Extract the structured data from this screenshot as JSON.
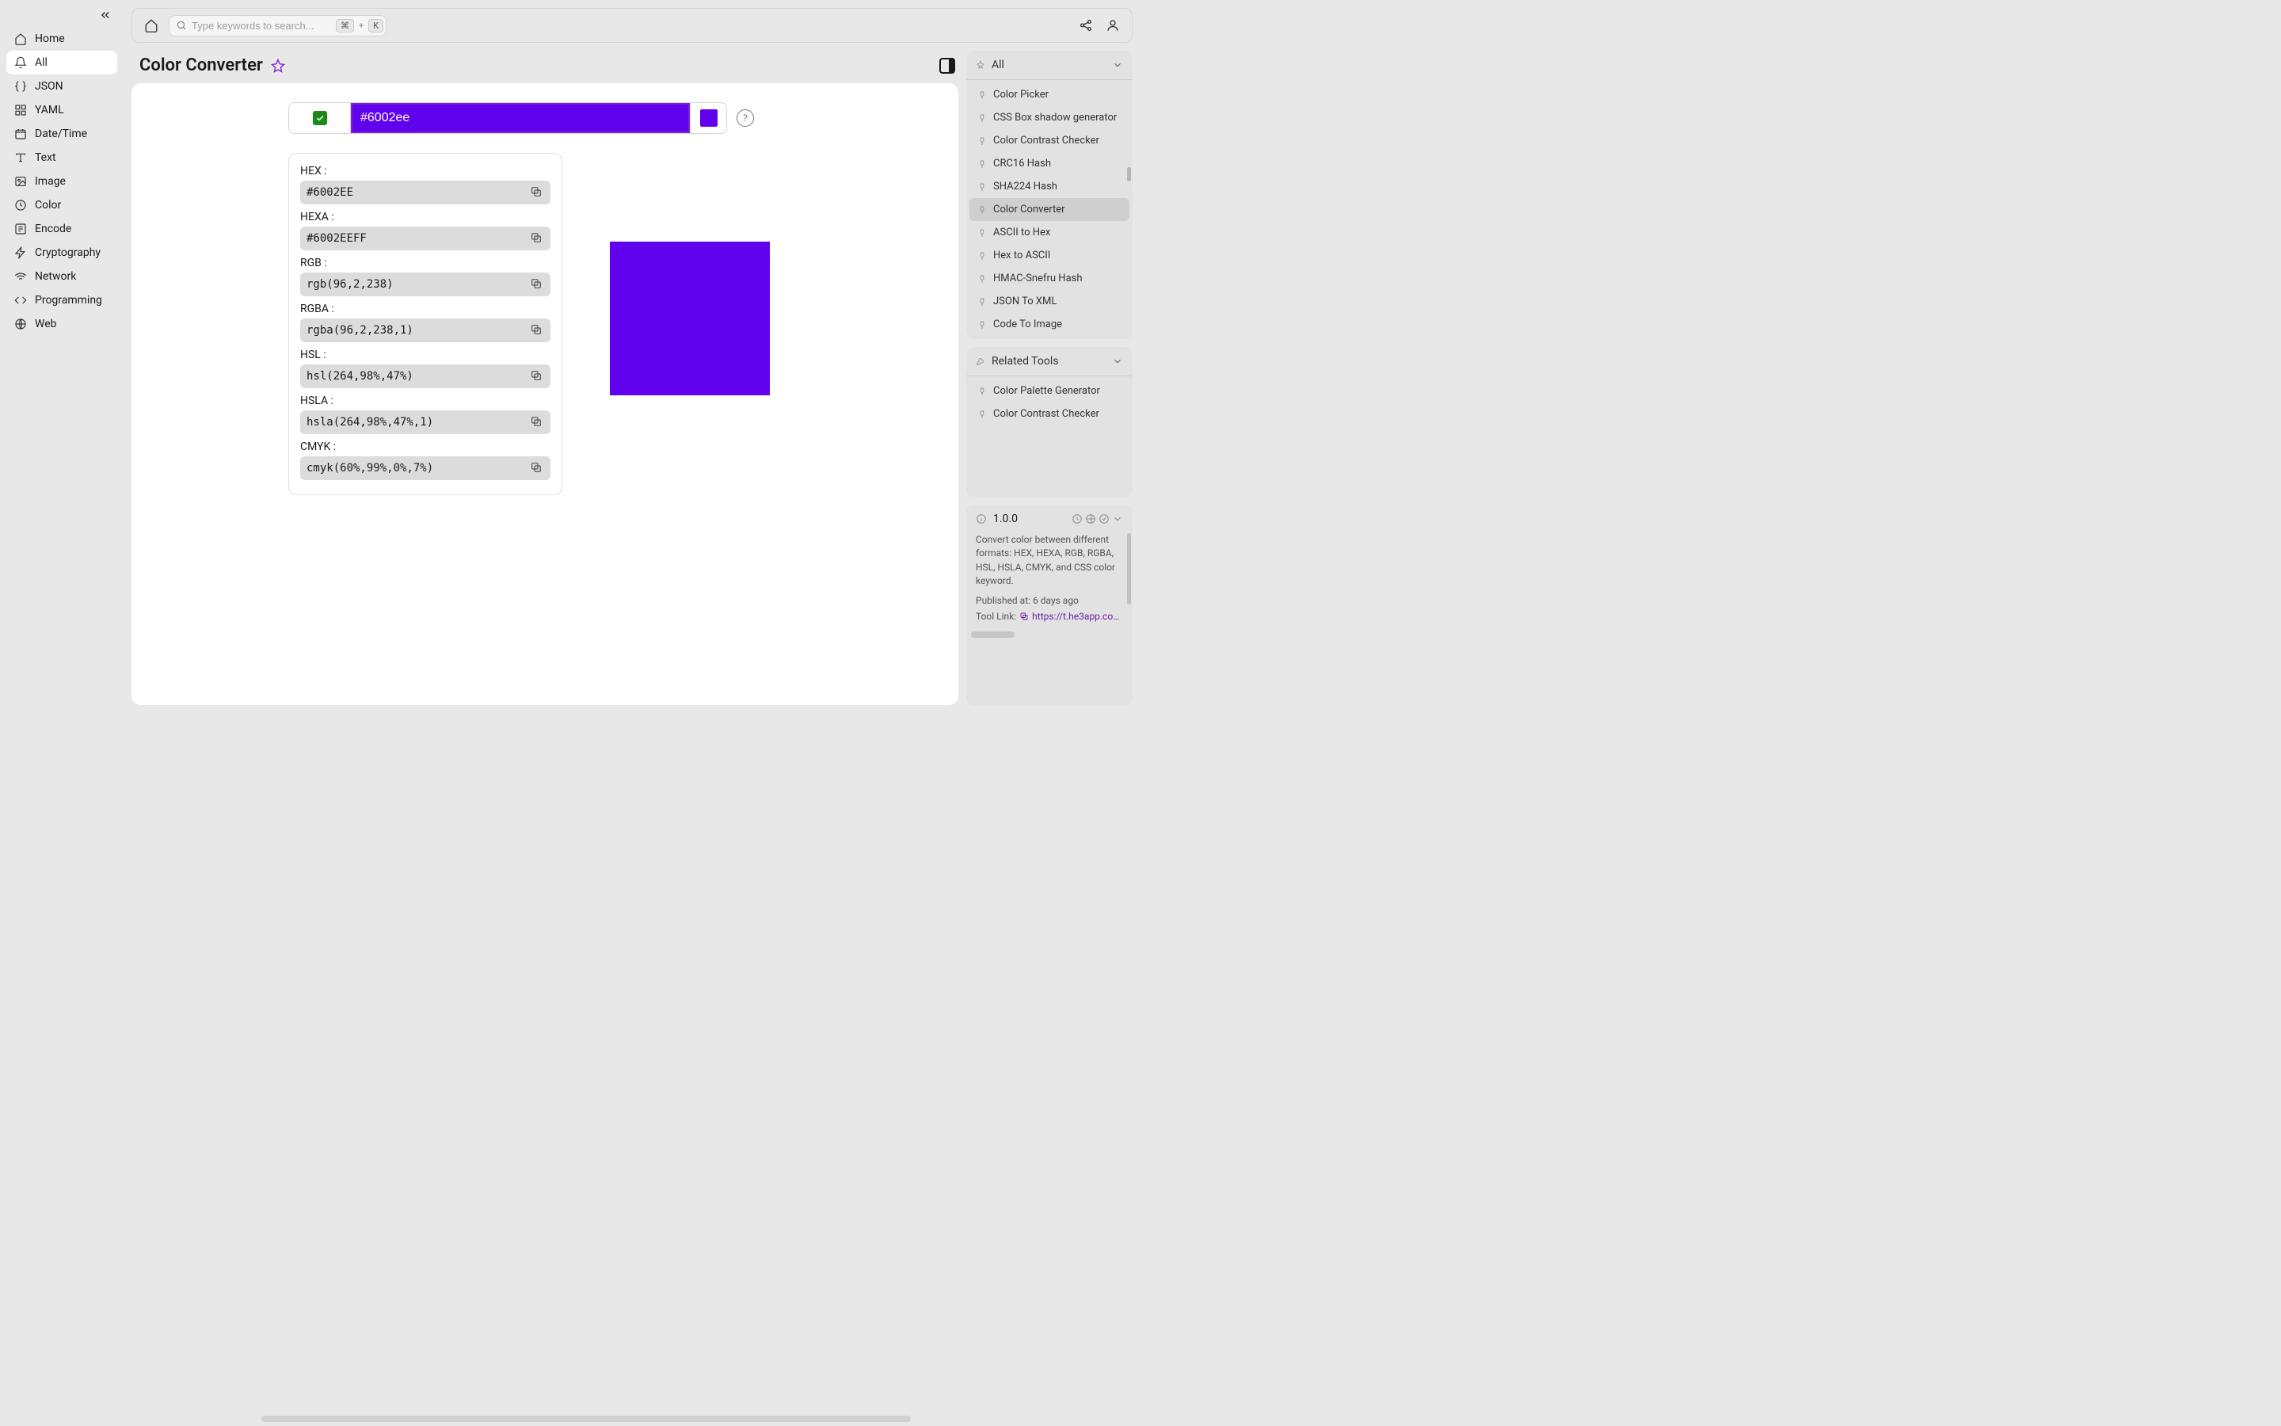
{
  "sidebar": {
    "items": [
      {
        "label": "Home"
      },
      {
        "label": "All"
      },
      {
        "label": "JSON"
      },
      {
        "label": "YAML"
      },
      {
        "label": "Date/Time"
      },
      {
        "label": "Text"
      },
      {
        "label": "Image"
      },
      {
        "label": "Color"
      },
      {
        "label": "Encode"
      },
      {
        "label": "Cryptography"
      },
      {
        "label": "Network"
      },
      {
        "label": "Programming"
      },
      {
        "label": "Web"
      }
    ]
  },
  "search": {
    "placeholder": "Type keywords to search...",
    "shortcut_mod": "⌘",
    "shortcut_plus": "+",
    "shortcut_key": "K"
  },
  "page": {
    "title": "Color Converter"
  },
  "input": {
    "value": "#6002ee",
    "swatch_color": "#6002ee"
  },
  "formats": [
    {
      "label": "HEX :",
      "value": "#6002EE"
    },
    {
      "label": "HEXA :",
      "value": "#6002EEFF"
    },
    {
      "label": "RGB :",
      "value": "rgb(96,2,238)"
    },
    {
      "label": "RGBA :",
      "value": "rgba(96,2,238,1)"
    },
    {
      "label": "HSL :",
      "value": "hsl(264,98%,47%)"
    },
    {
      "label": "HSLA :",
      "value": "hsla(264,98%,47%,1)"
    },
    {
      "label": "CMYK :",
      "value": "cmyk(60%,99%,0%,7%)"
    }
  ],
  "right": {
    "all_label": "All",
    "all_items": [
      {
        "label": "Color Picker"
      },
      {
        "label": "CSS Box shadow generator"
      },
      {
        "label": "Color Contrast Checker"
      },
      {
        "label": "CRC16 Hash"
      },
      {
        "label": "SHA224 Hash"
      },
      {
        "label": "Color Converter"
      },
      {
        "label": "ASCII to Hex"
      },
      {
        "label": "Hex to ASCII"
      },
      {
        "label": "HMAC-Snefru Hash"
      },
      {
        "label": "JSON To XML"
      },
      {
        "label": "Code To Image"
      }
    ],
    "related_label": "Related Tools",
    "related_items": [
      {
        "label": "Color Palette Generator"
      },
      {
        "label": "Color Contrast Checker"
      }
    ]
  },
  "info": {
    "version": "1.0.0",
    "description": "Convert color between different formats: HEX, HEXA, RGB, RGBA, HSL, HSLA, CMYK, and CSS color keyword.",
    "published_label": "Published at:",
    "published_value": "6 days ago",
    "link_label": "Tool Link:",
    "link_value": "https://t.he3app.co…"
  }
}
